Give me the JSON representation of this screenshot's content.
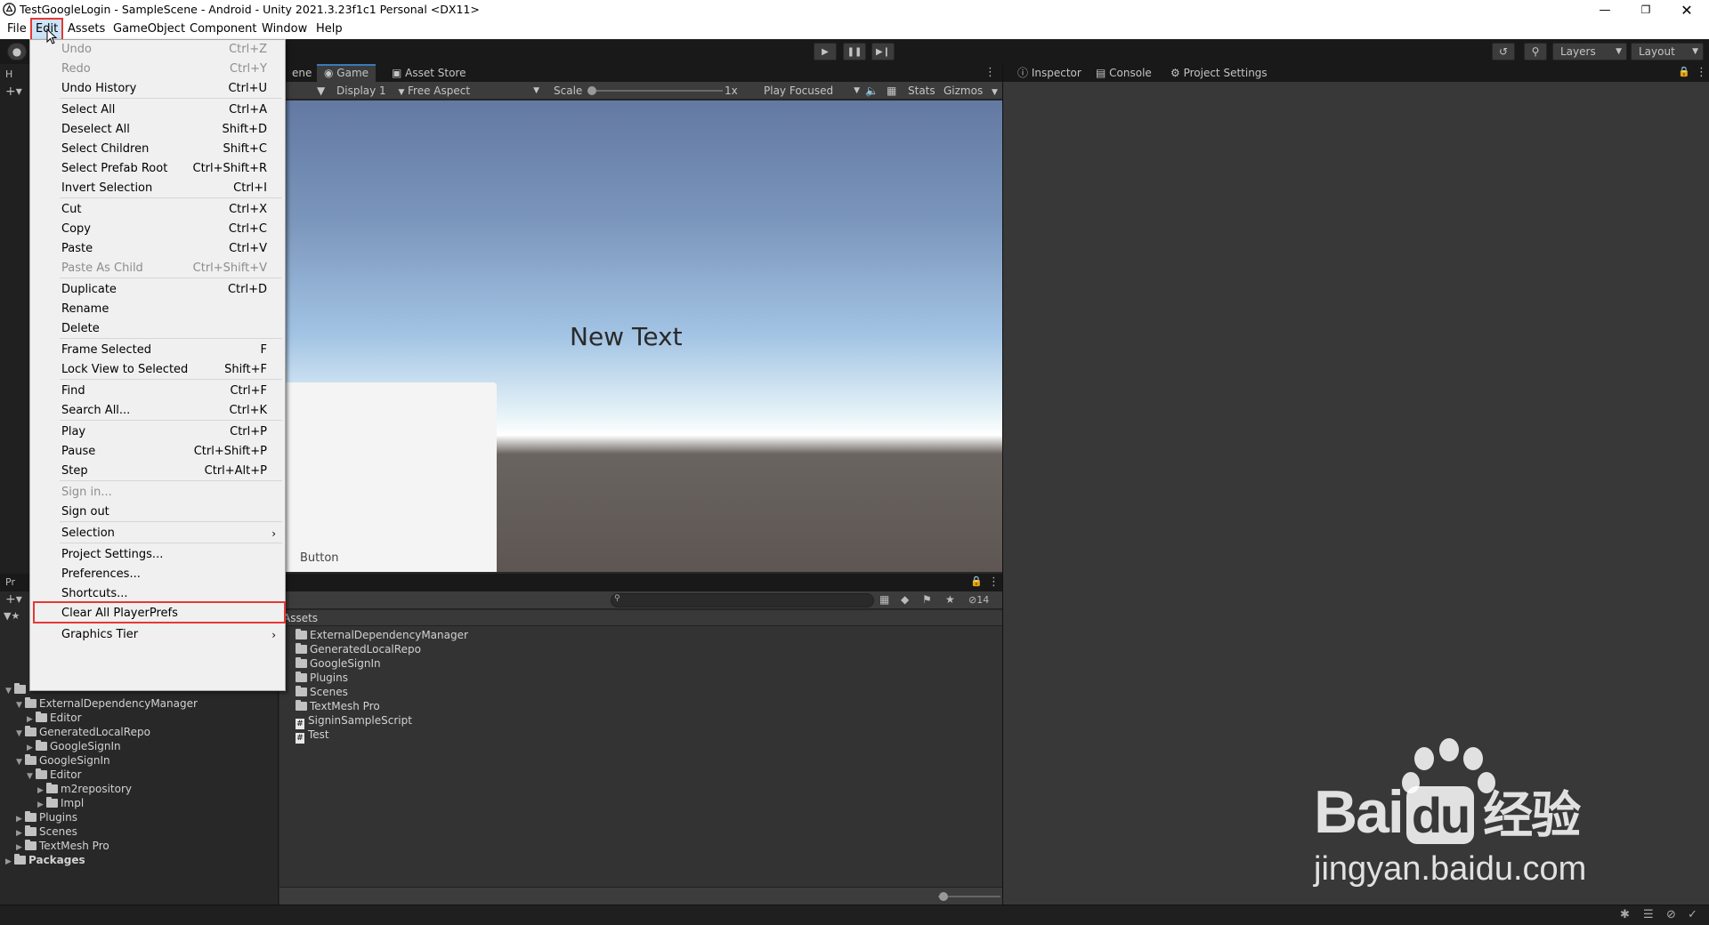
{
  "window": {
    "title": "TestGoogleLogin - SampleScene - Android - Unity 2021.3.23f1c1 Personal <DX11>"
  },
  "menubar": {
    "items": [
      "File",
      "Edit",
      "Assets",
      "GameObject",
      "Component",
      "Window",
      "Help"
    ]
  },
  "toolbar": {
    "layers_label": "Layers",
    "layout_label": "Layout"
  },
  "left_panel": {
    "hierarchy_tab": "H",
    "project_tab": "Pr"
  },
  "game_panel": {
    "tabs": {
      "scene": "ene",
      "game": "Game",
      "asset_store": "Asset Store"
    },
    "toolbar": {
      "display": "Display 1",
      "aspect": "Free Aspect",
      "scale_label": "Scale",
      "scale_value": "1x",
      "play_mode": "Play Focused",
      "stats": "Stats",
      "gizmos": "Gizmos"
    },
    "scene_text": "New Text",
    "button_text": "Button"
  },
  "right_panel": {
    "tabs": [
      "Inspector",
      "Console",
      "Project Settings"
    ]
  },
  "project": {
    "assets_header": "Assets",
    "hidden_count": "14",
    "assets": [
      {
        "name": "ExternalDependencyManager",
        "kind": "folder"
      },
      {
        "name": "GeneratedLocalRepo",
        "kind": "folder"
      },
      {
        "name": "GoogleSignIn",
        "kind": "folder"
      },
      {
        "name": "Plugins",
        "kind": "folder"
      },
      {
        "name": "Scenes",
        "kind": "folder"
      },
      {
        "name": "TextMesh Pro",
        "kind": "folder"
      },
      {
        "name": "SigninSampleScript",
        "kind": "script"
      },
      {
        "name": "Test",
        "kind": "script"
      }
    ],
    "tree": [
      {
        "name": "ExternalDependencyManager",
        "level": 1,
        "expanded": true
      },
      {
        "name": "Editor",
        "level": 2,
        "expanded": false
      },
      {
        "name": "GeneratedLocalRepo",
        "level": 1,
        "expanded": true
      },
      {
        "name": "GoogleSignIn",
        "level": 2,
        "expanded": false
      },
      {
        "name": "GoogleSignIn",
        "level": 1,
        "expanded": true
      },
      {
        "name": "Editor",
        "level": 2,
        "expanded": true
      },
      {
        "name": "m2repository",
        "level": 3,
        "expanded": false
      },
      {
        "name": "Impl",
        "level": 3,
        "expanded": false
      },
      {
        "name": "Plugins",
        "level": 1,
        "expanded": false
      },
      {
        "name": "Scenes",
        "level": 1,
        "expanded": false
      },
      {
        "name": "TextMesh Pro",
        "level": 1,
        "expanded": false
      },
      {
        "name": "Packages",
        "level": 0,
        "expanded": false
      }
    ]
  },
  "edit_menu": {
    "items": [
      {
        "label": "Undo",
        "shortcut": "Ctrl+Z",
        "disabled": true
      },
      {
        "label": "Redo",
        "shortcut": "Ctrl+Y",
        "disabled": true
      },
      {
        "label": "Undo History",
        "shortcut": "Ctrl+U",
        "disabled": false
      },
      {
        "label": "Select All",
        "shortcut": "Ctrl+A",
        "disabled": false
      },
      {
        "label": "Deselect All",
        "shortcut": "Shift+D",
        "disabled": false
      },
      {
        "label": "Select Children",
        "shortcut": "Shift+C",
        "disabled": false
      },
      {
        "label": "Select Prefab Root",
        "shortcut": "Ctrl+Shift+R",
        "disabled": false
      },
      {
        "label": "Invert Selection",
        "shortcut": "Ctrl+I",
        "disabled": false
      },
      {
        "label": "Cut",
        "shortcut": "Ctrl+X",
        "disabled": false
      },
      {
        "label": "Copy",
        "shortcut": "Ctrl+C",
        "disabled": false
      },
      {
        "label": "Paste",
        "shortcut": "Ctrl+V",
        "disabled": false
      },
      {
        "label": "Paste As Child",
        "shortcut": "Ctrl+Shift+V",
        "disabled": true
      },
      {
        "label": "Duplicate",
        "shortcut": "Ctrl+D",
        "disabled": false
      },
      {
        "label": "Rename",
        "shortcut": "",
        "disabled": false
      },
      {
        "label": "Delete",
        "shortcut": "",
        "disabled": false
      },
      {
        "label": "Frame Selected",
        "shortcut": "F",
        "disabled": false
      },
      {
        "label": "Lock View to Selected",
        "shortcut": "Shift+F",
        "disabled": false
      },
      {
        "label": "Find",
        "shortcut": "Ctrl+F",
        "disabled": false
      },
      {
        "label": "Search All...",
        "shortcut": "Ctrl+K",
        "disabled": false
      },
      {
        "label": "Play",
        "shortcut": "Ctrl+P",
        "disabled": false
      },
      {
        "label": "Pause",
        "shortcut": "Ctrl+Shift+P",
        "disabled": false
      },
      {
        "label": "Step",
        "shortcut": "Ctrl+Alt+P",
        "disabled": false
      },
      {
        "label": "Sign in...",
        "shortcut": "",
        "disabled": true
      },
      {
        "label": "Sign out",
        "shortcut": "",
        "disabled": false
      },
      {
        "label": "Selection",
        "shortcut": "",
        "disabled": false,
        "submenu": true
      },
      {
        "label": "Project Settings...",
        "shortcut": "",
        "disabled": false
      },
      {
        "label": "Preferences...",
        "shortcut": "",
        "disabled": false,
        "highlighted": true
      },
      {
        "label": "Shortcuts...",
        "shortcut": "",
        "disabled": false
      },
      {
        "label": "Clear All PlayerPrefs",
        "shortcut": "",
        "disabled": false
      },
      {
        "label": "Graphics Tier",
        "shortcut": "",
        "disabled": false,
        "submenu": true
      }
    ]
  },
  "watermark": {
    "brand": "Bai",
    "brand_du": "du",
    "brand_cn": "经验",
    "url": "jingyan.baidu.com"
  },
  "colors": {
    "highlight_red": "#e53935",
    "accent_blue": "#3a79bb"
  }
}
